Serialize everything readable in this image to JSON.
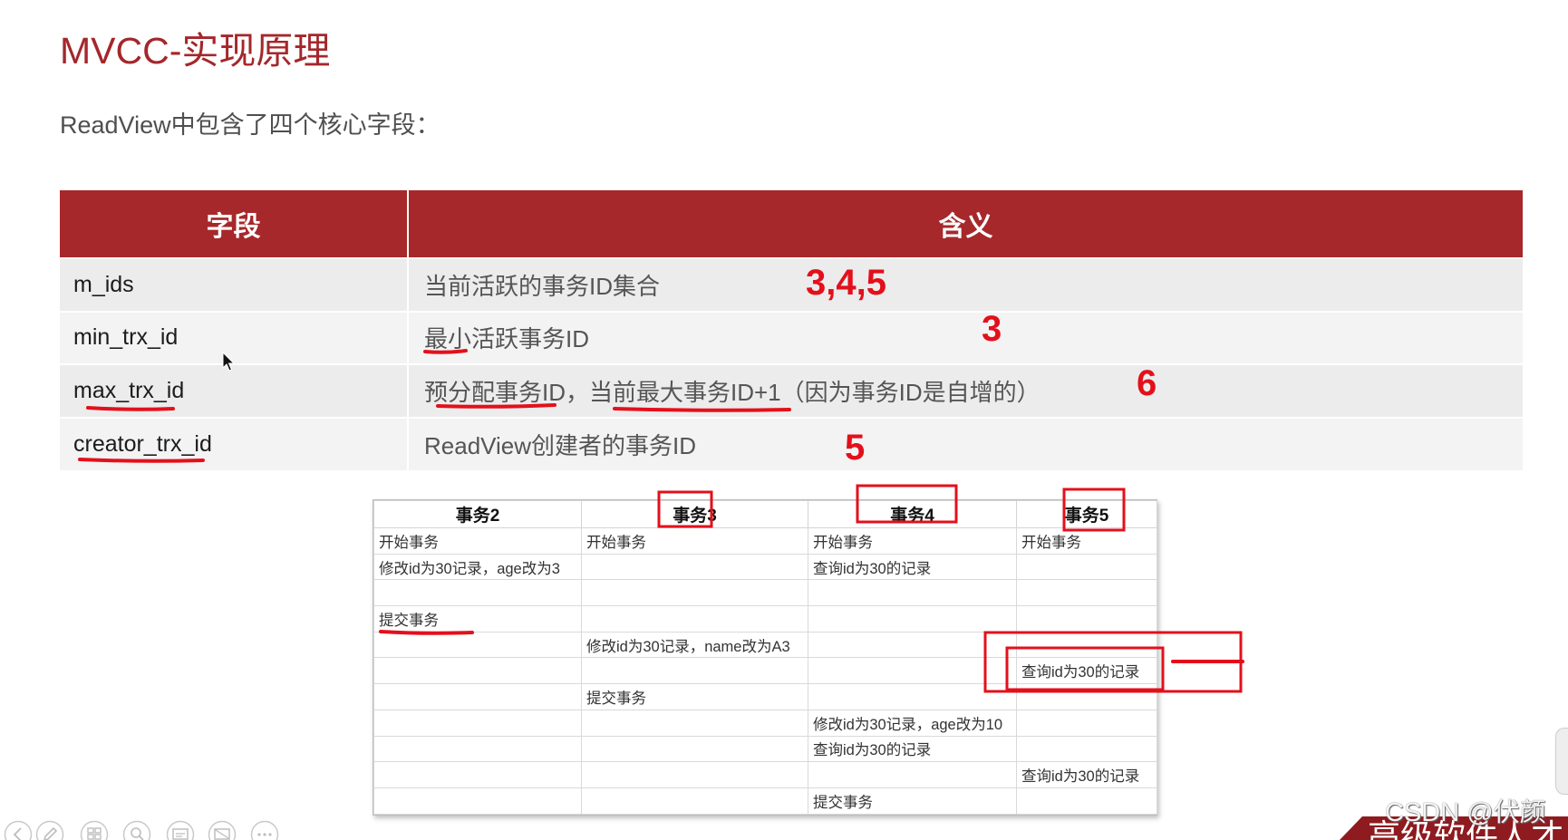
{
  "slide": {
    "title": "MVCC-实现原理",
    "subtitle": "ReadView中包含了四个核心字段："
  },
  "fields_table": {
    "headers": [
      "字段",
      "含义"
    ],
    "rows": [
      {
        "field": "m_ids",
        "meaning": "当前活跃的事务ID集合",
        "annotation": "3,4,5"
      },
      {
        "field": "min_trx_id",
        "meaning": "最小活跃事务ID",
        "annotation": "3"
      },
      {
        "field": "max_trx_id",
        "meaning": "预分配事务ID，当前最大事务ID+1（因为事务ID是自增的）",
        "annotation": "6"
      },
      {
        "field": "creator_trx_id",
        "meaning": "ReadView创建者的事务ID",
        "annotation": "5"
      }
    ]
  },
  "transactions_table": {
    "headers": [
      "事务2",
      "事务3",
      "事务4",
      "事务5"
    ],
    "rows": [
      [
        "开始事务",
        "开始事务",
        "开始事务",
        "开始事务"
      ],
      [
        "修改id为30记录，age改为3",
        "",
        "查询id为30的记录",
        ""
      ],
      [
        "",
        "",
        "",
        ""
      ],
      [
        "提交事务",
        "",
        "",
        ""
      ],
      [
        "",
        "修改id为30记录，name改为A3",
        "",
        ""
      ],
      [
        "",
        "",
        "",
        "查询id为30的记录"
      ],
      [
        "",
        "提交事务",
        "",
        ""
      ],
      [
        "",
        "",
        "修改id为30记录，age改为10",
        ""
      ],
      [
        "",
        "",
        "查询id为30的记录",
        ""
      ],
      [
        "",
        "",
        "",
        "查询id为30的记录"
      ],
      [
        "",
        "",
        "提交事务",
        ""
      ]
    ]
  },
  "toolbar": {
    "icons": [
      "previous-icon",
      "pen-icon",
      "slides-grid-icon",
      "zoom-icon",
      "subtitles-icon",
      "screen-icon",
      "more-icon"
    ]
  },
  "footer": {
    "watermark": "CSDN @伏颜",
    "banner_text": "高级软件人才"
  },
  "colors": {
    "brand_red": "#A6282B",
    "annotation_red": "#E3101B",
    "banner_red": "#8E1B1F",
    "row_bg_odd": "#ECECEC",
    "row_bg_even": "#F3F3F3",
    "body_text": "#555555"
  }
}
